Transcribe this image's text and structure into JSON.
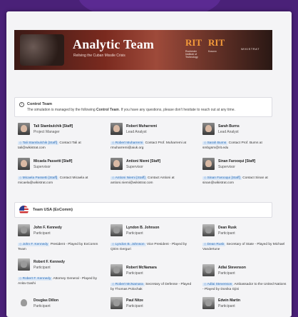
{
  "banner": {
    "title": "Analytic Team",
    "subtitle": "Reliving the Cuban Missile Crisis",
    "logo1": "RIT",
    "logo1_sub": "Rochester Institute of Technology",
    "logo2": "RIT",
    "logo2_sub": "Kosovo",
    "logo3": "WIKISTRAT"
  },
  "control": {
    "title": "Control Team",
    "desc_pre": "The simulation is managed by the following ",
    "desc_bold": "Control Team",
    "desc_post": ". If you have any questions, please don't hesitate to reach out at any time."
  },
  "control_members": [
    {
      "name": "Tali Stambulchik [Staff]",
      "role": "Project Manager",
      "tag": "Tali Stambulchik [Staff]",
      "desc": " Contact Tali at tali@wikistrat.com"
    },
    {
      "name": "Robert Muharremi",
      "role": "Lead Analyst",
      "tag": "Robert Muharremi",
      "desc": " Contact Prof. Muharremi at rmuharremi@aiuk.org"
    },
    {
      "name": "Sarah Burns",
      "role": "Lead Analyst",
      "tag": "Sarah Burns",
      "desc": " Contact Prof. Burns at smbgsm@rit.edu"
    },
    {
      "name": "Micaela Passetti [Staff]",
      "role": "Supervisor",
      "tag": "Micaela Passetti [Staff]",
      "desc": " Contact Micaela at micaela@wikistrat.com"
    },
    {
      "name": "Antioni Niemi [Staff]",
      "role": "Supervisor",
      "tag": "Antioni Niemi [Staff]",
      "desc": " Contact Antioni at antioni.niemi@wikistrat.com"
    },
    {
      "name": "Sinan Farooqui [Staff]",
      "role": "Supervisor",
      "tag": "Sinan Farooqui [Staff]",
      "desc": " Contact Sinan at sinan@wikistrat.com"
    }
  ],
  "usa": {
    "title": "Team USA (ExComm)"
  },
  "usa_members": [
    {
      "name": "John F. Kennedy",
      "role": "Participant",
      "tag": "John F. Kennedy",
      "desc": " President - Played by ExComm Team"
    },
    {
      "name": "Lyndon B. Johnson",
      "role": "Participant",
      "tag": "Lyndon B. Johnson",
      "desc": " Vice President - Played by Qirim Gerguri"
    },
    {
      "name": "Dean Rusk",
      "role": "Participant",
      "tag": "Dean Rusk",
      "desc": " Secretary of State - Played by Michael Vandertune"
    },
    {
      "name": "Robert F. Kennedy",
      "role": "Participant",
      "tag": "Robert F. Kennedy",
      "desc": " Attorney General - Played by Anita Gashi"
    },
    {
      "name": "Robert McNamara",
      "role": "Participant",
      "tag": "Robert McNamara",
      "desc": " Secretary of Defense - Played by Thomas Polochak"
    },
    {
      "name": "Adlai Stevenson",
      "role": "Participant",
      "tag": "Adlai Stevenson",
      "desc": " Ambassador to the United Nations - Played by Donika Gjini"
    },
    {
      "name": "Douglas Dillon",
      "role": "Participant",
      "tag": "",
      "desc": ""
    },
    {
      "name": "Paul Nitze",
      "role": "Participant",
      "tag": "",
      "desc": ""
    },
    {
      "name": "Edwin Martin",
      "role": "Participant",
      "tag": "",
      "desc": ""
    }
  ]
}
